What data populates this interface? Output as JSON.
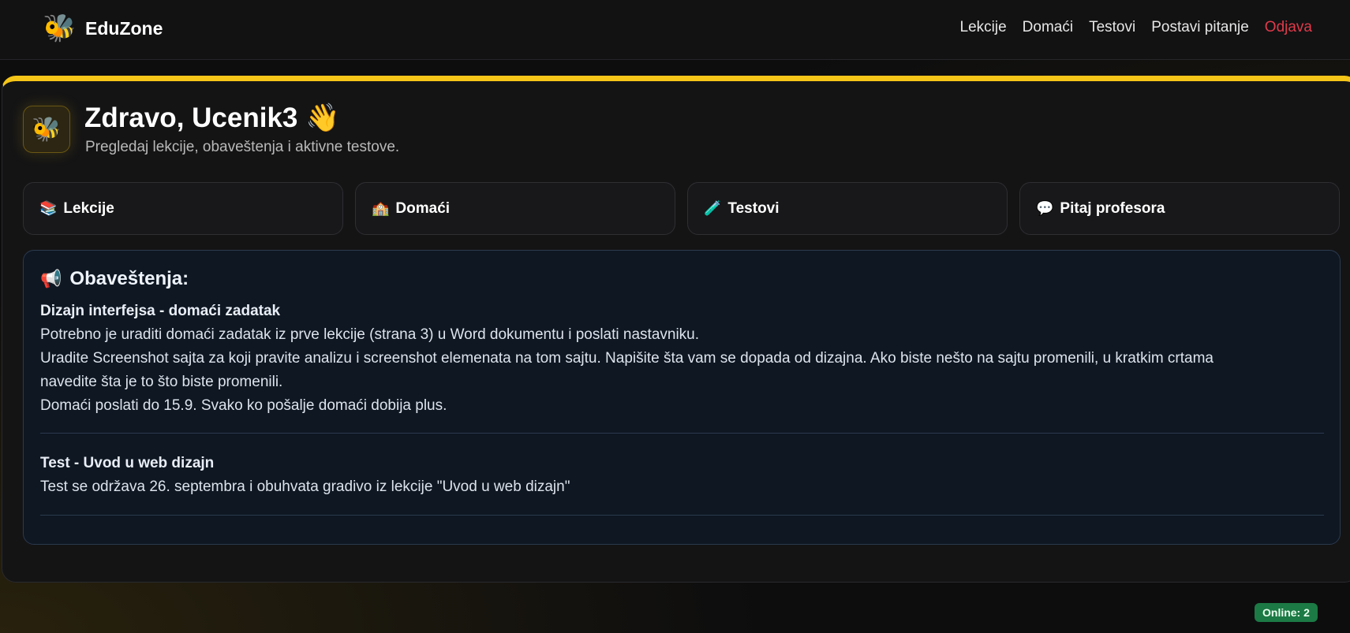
{
  "app": {
    "brand_icon": "bee-emoji",
    "brand_name": "EduZone"
  },
  "nav": {
    "links": [
      {
        "label": "Lekcije"
      },
      {
        "label": "Domaći"
      },
      {
        "label": "Testovi"
      },
      {
        "label": "Postavi pitanje"
      },
      {
        "label": "Odjava",
        "color": "#e03a4a"
      }
    ]
  },
  "hero": {
    "icon": "bee-emoji",
    "title": "Zdravo, Ucenik3 👋",
    "subtitle": "Pregledaj lekcije, obaveštenja i aktivne testove.",
    "accent_color": "#f5c518"
  },
  "quick_links": [
    {
      "icon": "📚",
      "label": "Lekcije"
    },
    {
      "icon": "🏫",
      "label": "Domaći"
    },
    {
      "icon": "🧪",
      "label": "Testovi"
    },
    {
      "icon": "💬",
      "label": "Pitaj profesora"
    }
  ],
  "notices": {
    "icon": "📢",
    "title": "Obaveštenja:",
    "items": [
      {
        "title": "Dizajn interfejsa - domaći zadatak",
        "lines": [
          "Potrebno je uraditi domaći zadatak iz prve lekcije (strana 3) u Word dokumentu i poslati nastavniku.",
          "Uradite Screenshot sajta za koji pravite analizu i screenshot elemenata na tom sajtu. Napišite šta vam se dopada od dizajna. Ako biste nešto na sajtu promenili, u kratkim crtama",
          "navedite šta je to što biste promenili.",
          "Domaći poslati do 15.9. Svako ko pošalje domaći dobija plus."
        ]
      },
      {
        "title": "Test - Uvod u web dizajn",
        "lines": [
          "Test se održava 26. septembra i obuhvata gradivo iz lekcije \"Uvod u web dizajn\""
        ]
      }
    ]
  },
  "status": {
    "online_label": "Online: 2",
    "online_color": "#1c7a44"
  }
}
